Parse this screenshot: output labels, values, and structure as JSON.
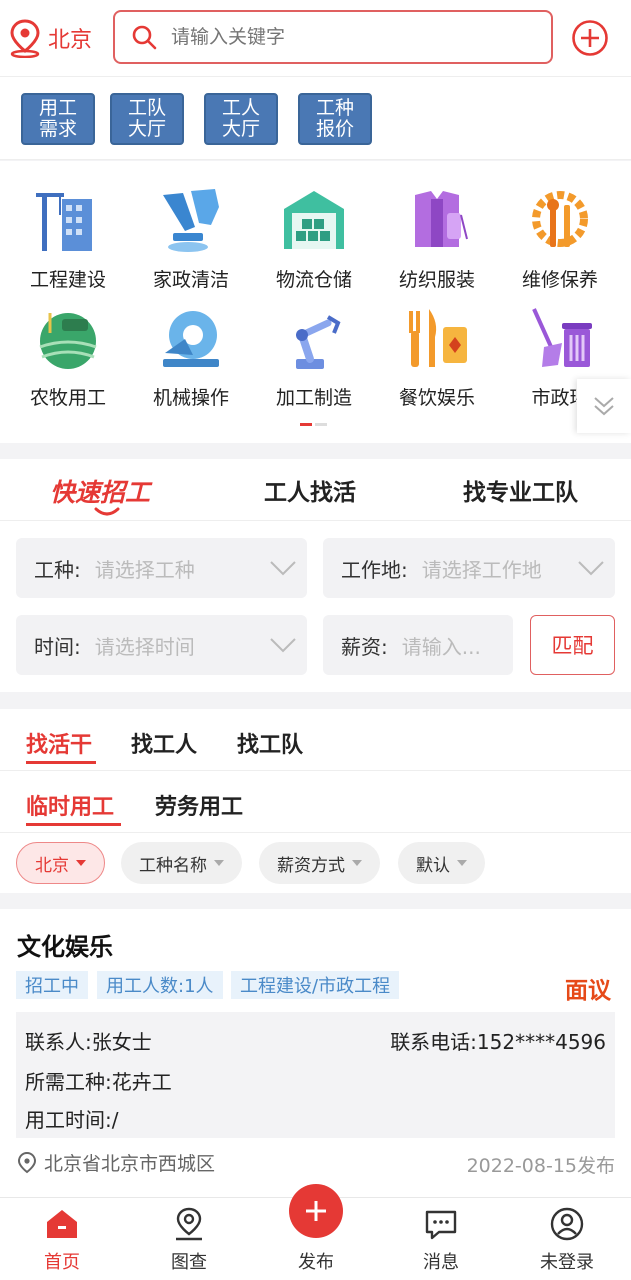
{
  "header": {
    "city": "北京",
    "search_placeholder": "请输入关键字",
    "accent": "#e53935"
  },
  "quick_tags": [
    "用工\n需求",
    "工队\n大厅",
    "工人\n大厅",
    "工种\n报价"
  ],
  "categories": [
    {
      "label": "工程建设",
      "icon": "construction-icon"
    },
    {
      "label": "家政清洁",
      "icon": "cleaning-icon"
    },
    {
      "label": "物流仓储",
      "icon": "warehouse-icon"
    },
    {
      "label": "纺织服装",
      "icon": "textile-icon"
    },
    {
      "label": "维修保养",
      "icon": "repair-icon"
    },
    {
      "label": "农牧用工",
      "icon": "farming-icon"
    },
    {
      "label": "机械操作",
      "icon": "saw-icon"
    },
    {
      "label": "加工制造",
      "icon": "robot-arm-icon"
    },
    {
      "label": "餐饮娱乐",
      "icon": "dining-icon"
    },
    {
      "label": "市政环",
      "icon": "sanitation-icon"
    }
  ],
  "recruit": {
    "tabs": [
      "快速招工",
      "工人找活",
      "找专业工队"
    ],
    "fields": {
      "trade_label": "工种:",
      "trade_placeholder": "请选择工种",
      "place_label": "工作地:",
      "place_placeholder": "请选择工作地",
      "time_label": "时间:",
      "time_placeholder": "请选择时间",
      "pay_label": "薪资:",
      "pay_placeholder": "请输入..."
    },
    "match_button": "匹配"
  },
  "listing": {
    "tabs": [
      "找活干",
      "找工人",
      "找工队"
    ],
    "subtabs": [
      "临时用工",
      "劳务用工"
    ],
    "filters": [
      "北京",
      "工种名称",
      "薪资方式",
      "默认"
    ]
  },
  "job": {
    "title": "文化娱乐",
    "badges": [
      "招工中",
      "用工人数:1人",
      "工程建设/市政工程"
    ],
    "salary": "面议",
    "contact": "联系人:张女士",
    "phone": "联系电话:152****4596",
    "trade": "所需工种:花卉工",
    "time": "用工时间:/",
    "address": "北京省北京市西城区",
    "date": "2022-08-15发布"
  },
  "nav": {
    "items": [
      "首页",
      "图查",
      "发布",
      "消息",
      "未登录"
    ]
  }
}
